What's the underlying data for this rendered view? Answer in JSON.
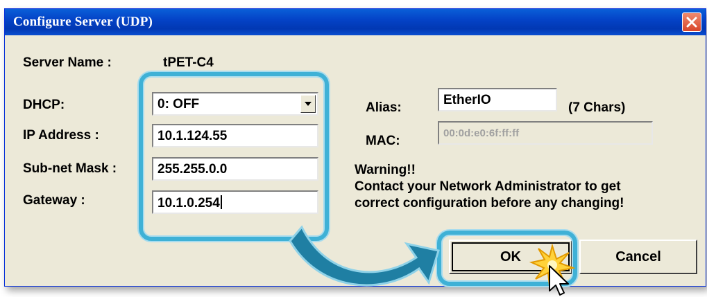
{
  "window": {
    "title": "Configure Server (UDP)"
  },
  "server_name": {
    "label": "Server Name :",
    "value": "tPET-C4"
  },
  "dhcp": {
    "label": "DHCP:",
    "value": "0: OFF"
  },
  "ip_address": {
    "label": "IP Address :",
    "value": "10.1.124.55"
  },
  "subnet_mask": {
    "label": "Sub-net Mask :",
    "value": "255.255.0.0"
  },
  "gateway": {
    "label": "Gateway :",
    "value": "10.1.0.254"
  },
  "alias": {
    "label": "Alias:",
    "value": "EtherIO",
    "hint": "(7 Chars)"
  },
  "mac": {
    "label": "MAC:",
    "value": "00:0d:e0:6f:ff:ff"
  },
  "warning": {
    "title": "Warning!!",
    "line1": "Contact your Network Administrator to get",
    "line2": "correct  configuration before any changing!"
  },
  "buttons": {
    "ok": "OK",
    "cancel": "Cancel"
  },
  "colors": {
    "titlebar": "#0443c7",
    "highlight": "#3fb1d6",
    "arrow": "#1f7fa3",
    "dialog_bg": "#ece9d8"
  }
}
